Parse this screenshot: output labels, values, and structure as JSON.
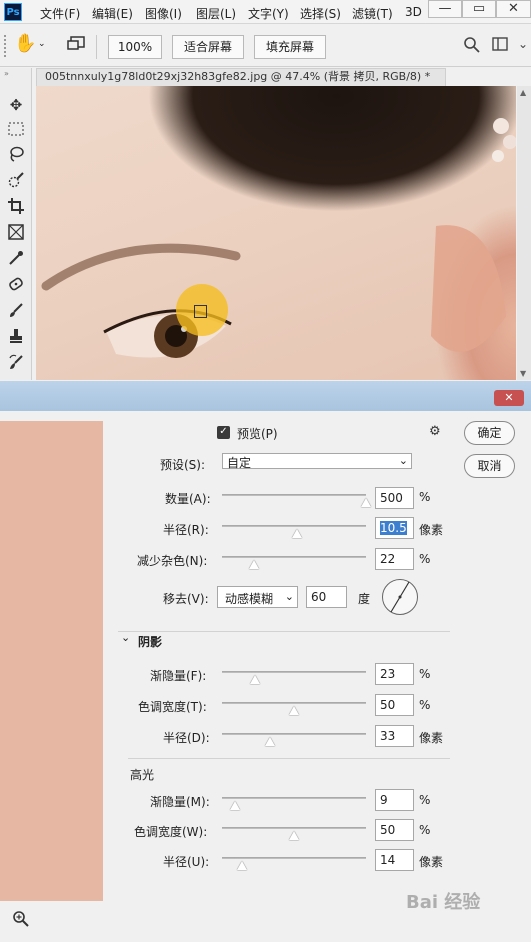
{
  "app": {
    "logo": "Ps"
  },
  "menu": [
    "文件(F)",
    "编辑(E)",
    "图像(I)",
    "图层(L)",
    "文字(Y)",
    "选择(S)",
    "滤镜(T)",
    "3D"
  ],
  "window_controls": {
    "minimize": "—",
    "restore": "▭",
    "close": "✕"
  },
  "options": {
    "zoom": "100%",
    "fit_screen": "适合屏幕",
    "fill_screen": "填充屏幕"
  },
  "document": {
    "tab_title": "005tnnxuly1g78ld0t29xj32h83gfe82.jpg @ 47.4% (背景 拷贝, RGB/8) *"
  },
  "tools": [
    "move",
    "marquee",
    "lasso",
    "quick-select",
    "crop",
    "frame",
    "eyedropper",
    "healing",
    "brush",
    "stamp",
    "history-brush"
  ],
  "dialog": {
    "preview_label": "预览(P)",
    "preview_checked": true,
    "ok_label": "确定",
    "cancel_label": "取消",
    "preset_label": "预设(S):",
    "preset_value": "自定",
    "amount_label": "数量(A):",
    "amount_value": "500",
    "amount_unit": "%",
    "amount_pct": 1.0,
    "radius_label": "半径(R):",
    "radius_value": "10.5",
    "radius_unit": "像素",
    "radius_pct": 0.52,
    "noise_label": "减少杂色(N):",
    "noise_value": "22",
    "noise_unit": "%",
    "noise_pct": 0.22,
    "remove_label": "移去(V):",
    "remove_value": "动感模糊",
    "angle_value": "60",
    "angle_unit": "度",
    "shadows": {
      "title": "阴影",
      "fade_label": "渐隐量(F):",
      "fade_value": "23",
      "fade_unit": "%",
      "fade_pct": 0.23,
      "tonal_label": "色调宽度(T):",
      "tonal_value": "50",
      "tonal_unit": "%",
      "tonal_pct": 0.5,
      "radius_label": "半径(D):",
      "radius_value": "33",
      "radius_unit": "像素",
      "radius_pct": 0.33
    },
    "highlights": {
      "title": "高光",
      "fade_label": "渐隐量(M):",
      "fade_value": "9",
      "fade_unit": "%",
      "fade_pct": 0.09,
      "tonal_label": "色调宽度(W):",
      "tonal_value": "50",
      "tonal_unit": "%",
      "tonal_pct": 0.5,
      "radius_label": "半径(U):",
      "radius_value": "14",
      "radius_unit": "像素",
      "radius_pct": 0.14
    }
  },
  "watermark": "Bai 经验"
}
